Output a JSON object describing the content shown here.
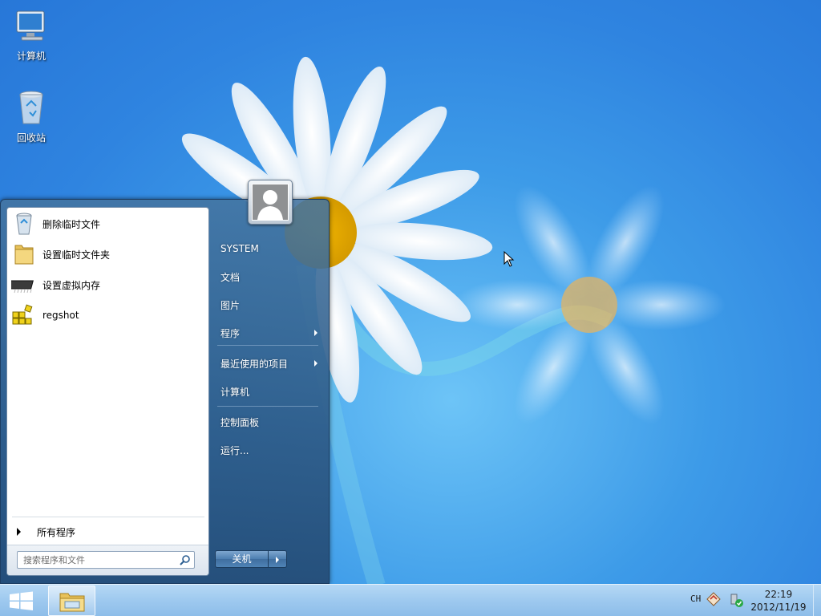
{
  "desktop": {
    "icons": [
      {
        "label": "计算机",
        "icon": "computer-icon"
      },
      {
        "label": "回收站",
        "icon": "recycle-bin-icon"
      }
    ]
  },
  "start_menu": {
    "programs": [
      {
        "label": "删除临时文件",
        "icon": "recycle-bin-icon"
      },
      {
        "label": "设置临时文件夹",
        "icon": "folder-icon"
      },
      {
        "label": "设置虚拟内存",
        "icon": "memory-chip-icon"
      },
      {
        "label": "regshot",
        "icon": "regshot-icon"
      }
    ],
    "all_programs_label": "所有程序",
    "search_placeholder": "搜索程序和文件",
    "right_items": {
      "user": "SYSTEM",
      "documents": "文档",
      "pictures": "图片",
      "programs": "程序",
      "recent": "最近使用的项目",
      "computer": "计算机",
      "control_panel": "控制面板",
      "run": "运行..."
    },
    "shutdown_label": "关机"
  },
  "taskbar": {
    "language": "CH",
    "time": "22:19",
    "date": "2012/11/19"
  },
  "colors": {
    "desktop_blue": "#2f84e0",
    "start_menu_glass": "#2d5a87",
    "taskbar": "#9ec9ef"
  }
}
